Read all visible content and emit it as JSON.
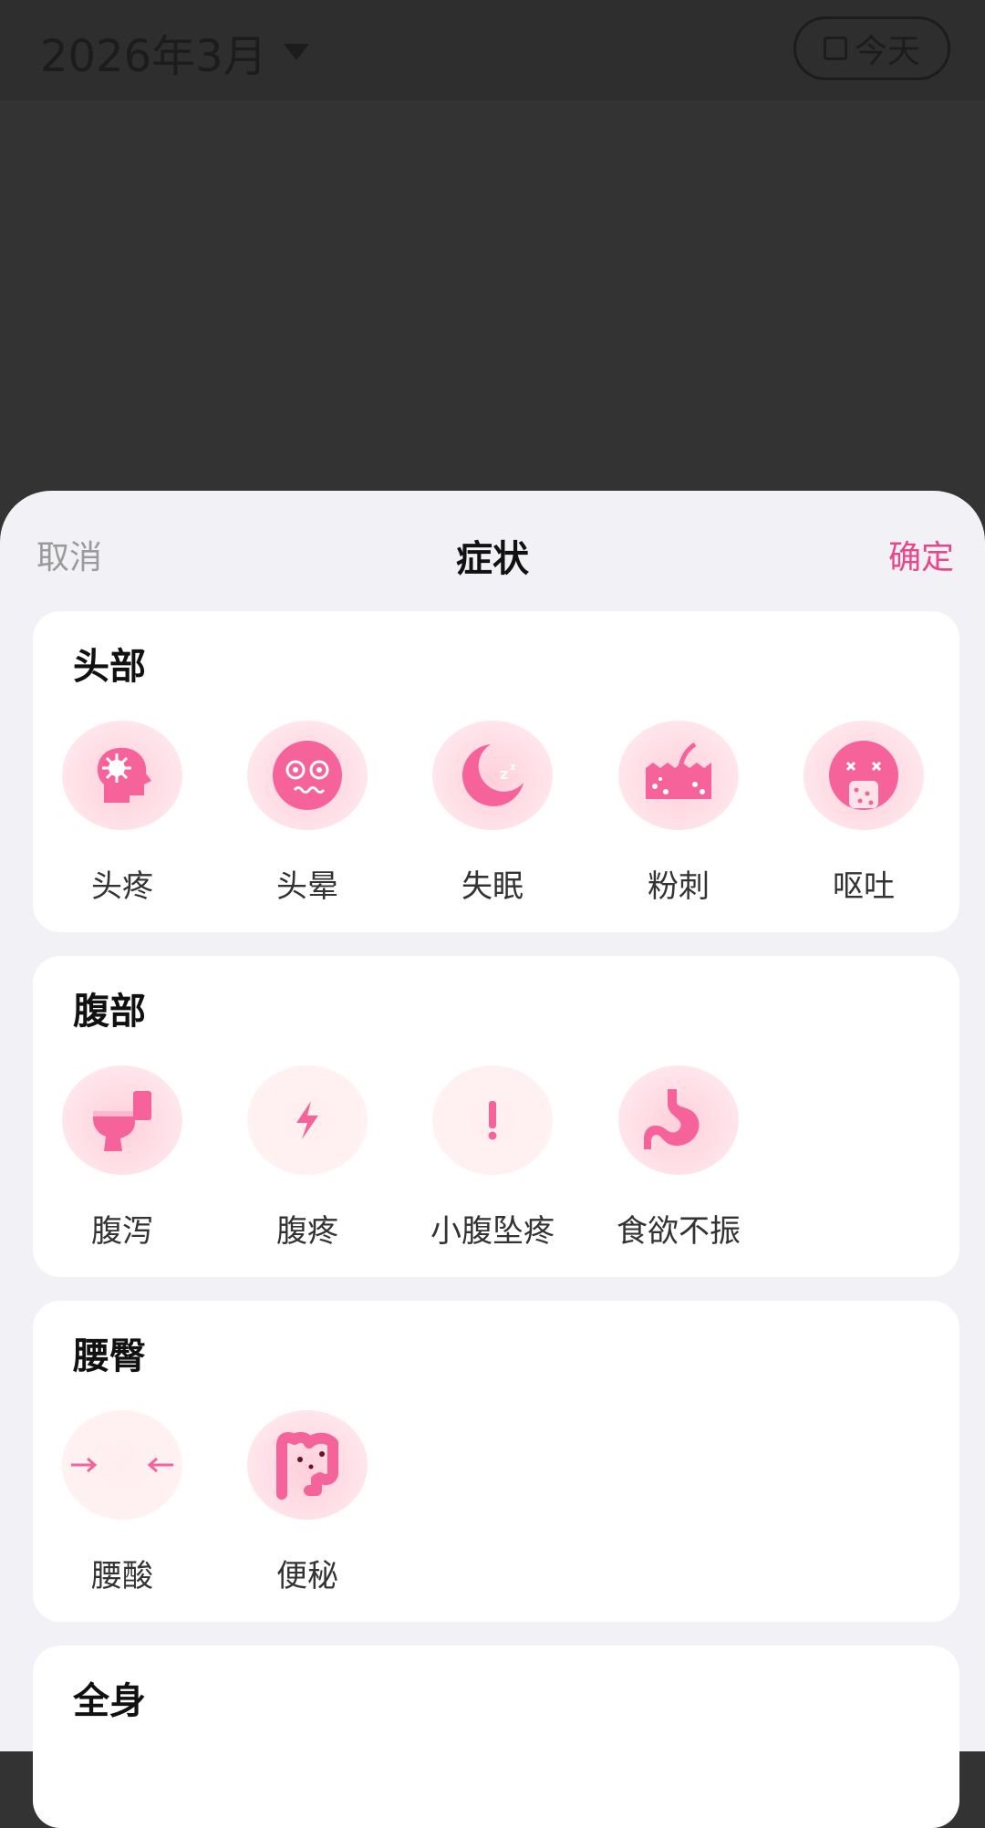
{
  "header": {
    "month": "2026年3月",
    "today_label": "今天"
  },
  "sheet": {
    "cancel": "取消",
    "title": "症状",
    "confirm": "确定",
    "accent": "#e8478b"
  },
  "sections": [
    {
      "title": "头部",
      "items": [
        {
          "label": "头疼",
          "icon": "headache-icon"
        },
        {
          "label": "头晕",
          "icon": "dizzy-icon"
        },
        {
          "label": "失眠",
          "icon": "insomnia-icon"
        },
        {
          "label": "粉刺",
          "icon": "acne-icon"
        },
        {
          "label": "呕吐",
          "icon": "vomit-icon"
        }
      ]
    },
    {
      "title": "腹部",
      "items": [
        {
          "label": "腹泻",
          "icon": "toilet-icon"
        },
        {
          "label": "腹疼",
          "icon": "lightning-icon"
        },
        {
          "label": "小腹坠疼",
          "icon": "exclamation-icon"
        },
        {
          "label": "食欲不振",
          "icon": "stomach-icon"
        }
      ]
    },
    {
      "title": "腰臀",
      "items": [
        {
          "label": "腰酸",
          "icon": "waist-arrows-icon"
        },
        {
          "label": "便秘",
          "icon": "intestine-icon"
        }
      ]
    },
    {
      "title": "全身",
      "items": []
    }
  ]
}
